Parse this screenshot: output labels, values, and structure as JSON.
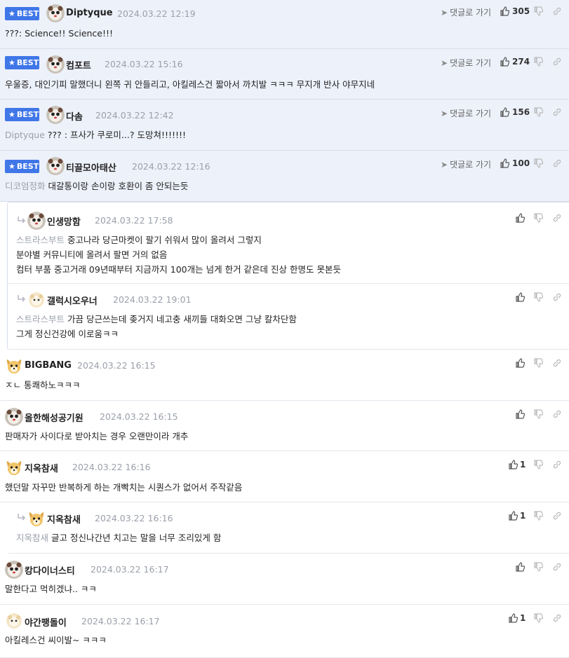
{
  "labels": {
    "best": "BEST",
    "goto": "댓글로 가기"
  },
  "colors": {
    "best_badge": "#3f76e8",
    "best_bg": "#edf1fa",
    "mention": "#9aa0aa"
  },
  "comments": [
    {
      "nick": "Diptyque",
      "date": "2024.03.22 12:19",
      "likes": "305",
      "mention": "",
      "lines": [
        "???: Science!! Science!!!"
      ]
    },
    {
      "nick": "컴포트",
      "date": "2024.03.22 15:16",
      "likes": "274",
      "mention": "",
      "lines": [
        "우울증, 대인기피 말했더니 왼쪽 귀 안들리고, 아킬레스건 짧아서 까치발 ㅋㅋㅋ 무지개 반사 야무지네"
      ]
    },
    {
      "nick": "다솜",
      "date": "2024.03.22 12:42",
      "likes": "156",
      "mention": "Diptyque",
      "lines": [
        "??? : 프사가 쿠로미...? 도망쳐!!!!!!!"
      ]
    },
    {
      "nick": "티끌모아태산",
      "date": "2024.03.22 12:16",
      "likes": "100",
      "mention": "디코엄정화",
      "lines": [
        "대갈통이랑 손이랑 호환이 좀 안되는듯"
      ]
    },
    {
      "nick": "인생망함",
      "date": "2024.03.22 17:58",
      "likes": "",
      "mention": "스트라스부트",
      "lines": [
        "중고나라 당근마켓이 팔기 쉬워서 많이 올려서 그렇지",
        "분야별 커뮤니티에 올려서 팔면 거의 없음",
        "컴터 부품 중고거래 09년때부터 지금까지 100개는 넘게 한거 같은데 진상 한명도 못본듯"
      ]
    },
    {
      "nick": "갤럭시오우너",
      "date": "2024.03.22 19:01",
      "likes": "",
      "mention": "스트라스부트",
      "lines": [
        "가끔 당근쓰는데 좆거지 네고충 새끼들 대화오면 그냥 칼차단함",
        "그게 정신건강에 이로움ㅋㅋ"
      ]
    },
    {
      "nick": "BIGBANG",
      "date": "2024.03.22 16:15",
      "likes": "",
      "mention": "",
      "lines": [
        "ㅈㄴ 통쾌하노ㅋㅋㅋ"
      ]
    },
    {
      "nick": "올한해성공기원",
      "date": "2024.03.22 16:15",
      "likes": "",
      "mention": "",
      "lines": [
        "판매자가 사이다로 받아치는 경우 오랜만이라 개추"
      ]
    },
    {
      "nick": "지옥참새",
      "date": "2024.03.22 16:16",
      "likes": "1",
      "mention": "",
      "lines": [
        "했던말 자꾸만 반복하게 하는 개빡치는 시퀀스가 없어서 주작같음"
      ]
    },
    {
      "nick": "지옥참새",
      "date": "2024.03.22 16:16",
      "likes": "1",
      "mention": "지옥참새",
      "lines": [
        "글고 정신나간년 치고는 말을 너무 조리있게 함"
      ]
    },
    {
      "nick": "캉다이너스티",
      "date": "2024.03.22 16:17",
      "likes": "",
      "mention": "",
      "lines": [
        "말한다고 먹히겠냐.. ㅋㅋ"
      ]
    },
    {
      "nick": "야간팽돌이",
      "date": "2024.03.22 16:17",
      "likes": "1",
      "mention": "",
      "lines": [
        "아킬레스건 씨이발~ ㅋㅋㅋ"
      ]
    }
  ]
}
